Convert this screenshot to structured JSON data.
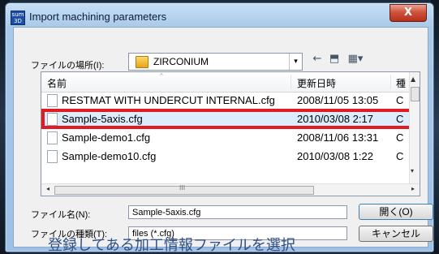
{
  "window": {
    "title": "Import machining parameters",
    "app_icon_text": "sum 3D",
    "close_label": "X"
  },
  "look_in": {
    "label": "ファイルの場所(I):",
    "value": "ZIRCONIUM",
    "dropdown_arrow": "▾"
  },
  "toolbar": {
    "back_glyph": "←",
    "up_folder_glyph": "⬒",
    "view_menu_glyph": "▦▾"
  },
  "file_list": {
    "columns": [
      "名前",
      "更新日時",
      "種"
    ],
    "rows": [
      {
        "name": "RESTMAT WITH UNDERCUT INTERNAL.cfg",
        "date": "2008/11/05 13:05",
        "type": "C"
      },
      {
        "name": "Sample-5axis.cfg",
        "date": "2010/03/08 2:17",
        "type": "C"
      },
      {
        "name": "Sample-demo1.cfg",
        "date": "2008/11/06 13:31",
        "type": "C"
      },
      {
        "name": "Sample-demo10.cfg",
        "date": "2010/03/08 1:22",
        "type": "C"
      }
    ],
    "selected_index": 1
  },
  "scrollbars": {
    "up": "▲",
    "down": "▾",
    "left": "◂",
    "right": "▸",
    "grip": "III"
  },
  "file_name": {
    "label": "ファイル名(N):",
    "value": "Sample-5axis.cfg"
  },
  "file_type": {
    "label": "ファイルの種類(T):",
    "value": "files (*.cfg)"
  },
  "buttons": {
    "open": "開く(O)",
    "cancel": "キャンセル"
  },
  "annotation": {
    "note": "登録してある加工情報ファイルを選択",
    "highlight_color": "#e11b22"
  }
}
